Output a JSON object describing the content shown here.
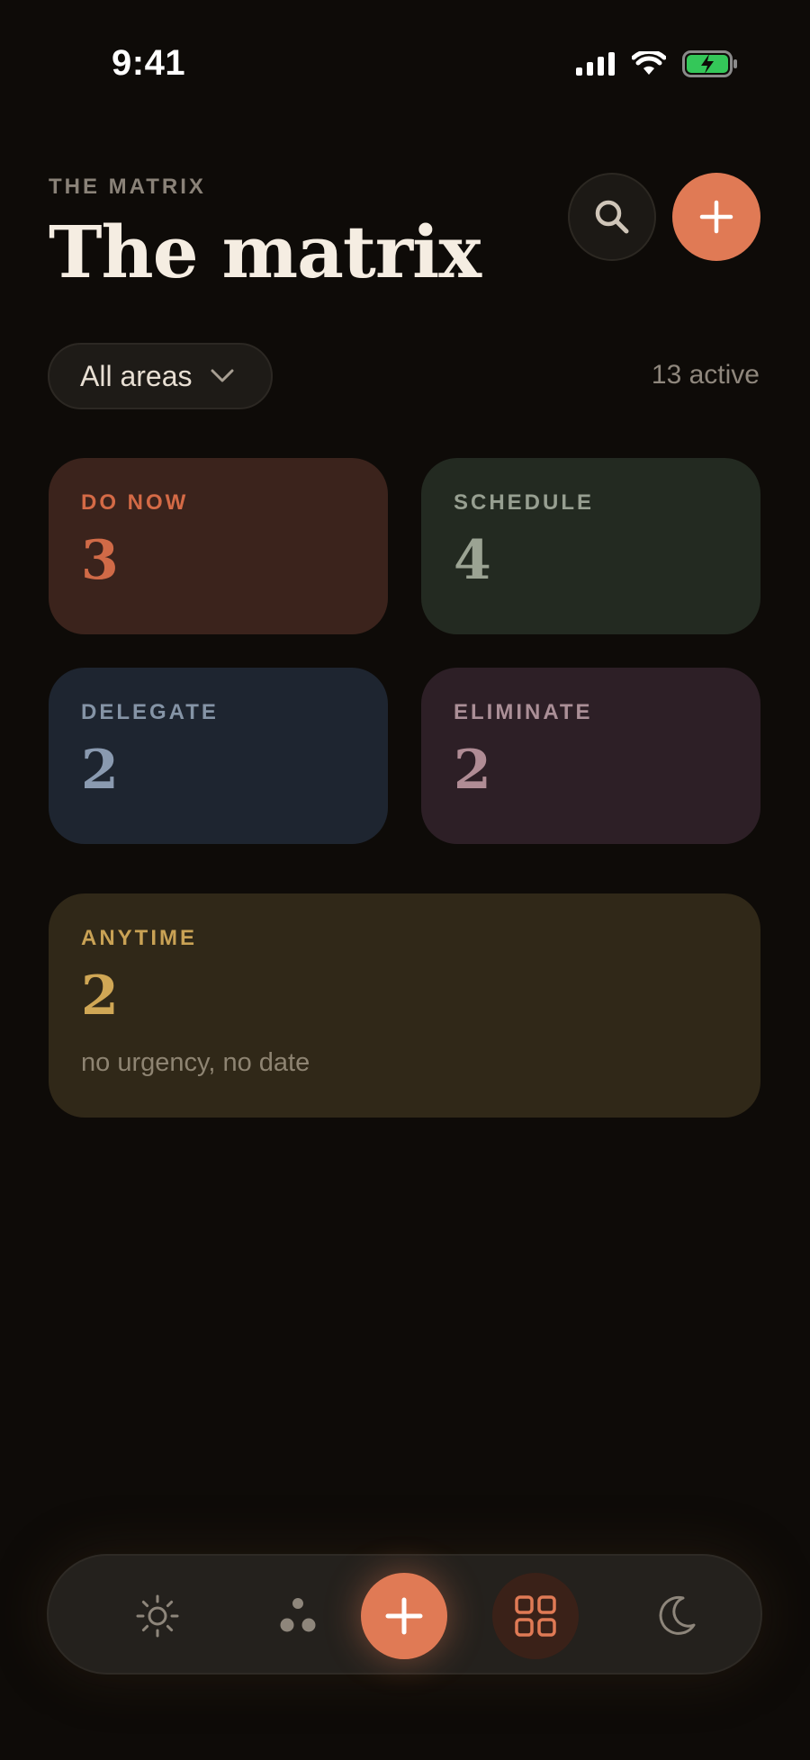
{
  "status_bar": {
    "time": "9:41",
    "icons": [
      "signal-icon",
      "wifi-icon",
      "battery-charging-icon"
    ]
  },
  "header": {
    "eyebrow": "THE MATRIX",
    "title": "The matrix",
    "search_icon": "search-icon",
    "add_icon": "plus-icon"
  },
  "filter": {
    "label": "All areas",
    "icon": "chevron-down-icon",
    "active_count": "13 active"
  },
  "quadrants": [
    {
      "label": "DO NOW",
      "count": "3",
      "color": "#d46a46"
    },
    {
      "label": "SCHEDULE",
      "count": "4",
      "color": "#979f91"
    },
    {
      "label": "DELEGATE",
      "count": "2",
      "color": "#8594a6"
    },
    {
      "label": "ELIMINATE",
      "count": "2",
      "color": "#ab8f97"
    }
  ],
  "anytime": {
    "label": "ANYTIME",
    "count": "2",
    "note": "no urgency, no date",
    "color": "#c9a255"
  },
  "tab_bar": {
    "items": [
      {
        "icon": "sun-icon",
        "active": false
      },
      {
        "icon": "areas-dots-icon",
        "active": false
      },
      {
        "icon": "plus-icon",
        "active": false
      },
      {
        "icon": "grid-icon",
        "active": true
      },
      {
        "icon": "moon-icon",
        "active": false
      }
    ],
    "accent": "#e07a55"
  }
}
